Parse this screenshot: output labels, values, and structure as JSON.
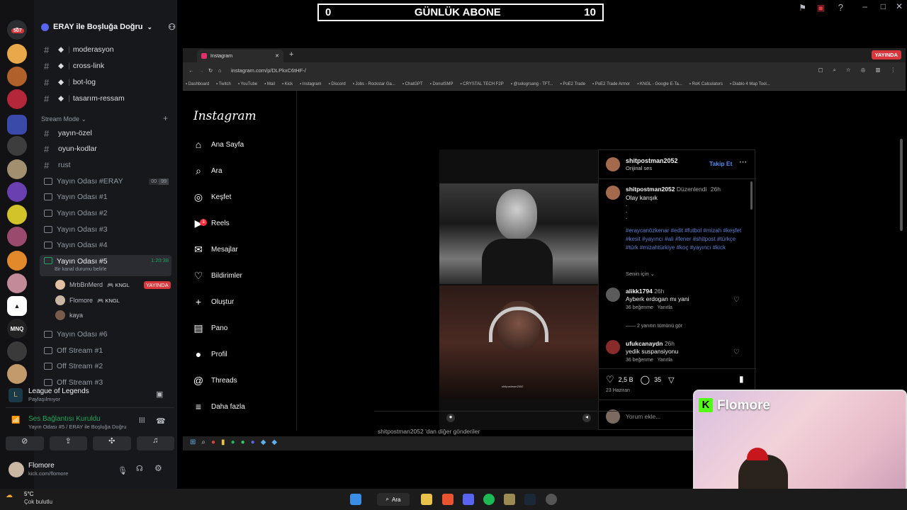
{
  "stream_overlay": {
    "left_count": "0",
    "title": "GÜNLÜK ABONE",
    "right_count": "10",
    "ghost_title": "ERAY ile Boşluğa Doğru"
  },
  "discord": {
    "badge_count": "507",
    "server_name": "ERAY ile Boşluğa Doğru",
    "text_channels": [
      "moderasyon",
      "cross-link",
      "bot-log",
      "tasarım-ressam"
    ],
    "category": "Stream Mode",
    "channels2": [
      "yayın-özel",
      "oyun-kodlar",
      "rust"
    ],
    "voice_channels_a": [
      "Yayın Odası #ERAY",
      "Yayın Odası #1",
      "Yayın Odası #2",
      "Yayın Odası #3",
      "Yayın Odası #4"
    ],
    "voice_counter": {
      "left": "00",
      "right": "99"
    },
    "active_voice": {
      "name": "Yayın Odası #5",
      "timer": "1:20:38",
      "status": "Bir kanal durumu belirle"
    },
    "voice_users": [
      {
        "name": "MrbBnMerd",
        "tag": "KNGL",
        "live": "YAYINDA"
      },
      {
        "name": "Flomore",
        "tag": "KNGL",
        "live": ""
      },
      {
        "name": "kaya",
        "tag": "",
        "live": ""
      }
    ],
    "voice_channels_b": [
      "Yayın Odası #6",
      "Off Stream #1",
      "Off Stream #2",
      "Off Stream #3"
    ],
    "activity": {
      "game": "League of Legends",
      "sub": "Paylaşılmıyor"
    },
    "connection": {
      "status": "Ses Bağlantısı Kuruldu",
      "detail": "Yayın Odası #5 / ERAY ile Boşluğa Doğru"
    },
    "user": {
      "name": "Flomore",
      "sub": "kick.com/flomore"
    }
  },
  "browser": {
    "tab_title": "Instagram",
    "url": "instagram.com/p/DLPkxC6tHF-/",
    "live_badge": "YAYINDA",
    "bookmarks": [
      "Dashboard",
      "Twitch",
      "YouTube",
      "Mail",
      "Kick",
      "Instagram",
      "Discord",
      "Jobs - Rockstar Ga...",
      "ChatGPT",
      "DonutSMP",
      "CRYSTAL TECH F2P",
      "@sologrsang - TFT...",
      "PoE2 Trade",
      "PoE2 Trade Armor",
      "KNGL - Google E-Ta...",
      "RoK Calculators",
      "Diablo 4 Map Tool..."
    ]
  },
  "instagram": {
    "logo": "Instagram",
    "nav": [
      "Ana Sayfa",
      "Ara",
      "Keşfet",
      "Reels",
      "Mesajlar",
      "Bildirimler",
      "Oluştur",
      "Pano",
      "Profil",
      "Threads",
      "Daha fazla"
    ],
    "messages_badge": "3",
    "post": {
      "author": "shitpostman2052",
      "audio": "Orijinal ses",
      "follow": "Takip Et",
      "edited": "Düzenlendi",
      "age": "26h",
      "caption": "Olay karışık",
      "dots": [
        ".",
        ".",
        "."
      ],
      "hashtags": "#eraycanözkenar #edit #futbol #mizah #keşfet #kesit #yayıncı #ali #fener #shitpost #türkçe #türk #mizahtürkiye #koç #yayıncı #kick",
      "for_you": "Senin için",
      "watermark": "shitpostman2052",
      "likes": "2,5 B",
      "comments_count": "35",
      "date": "23 Haziran",
      "add_comment": "Yorum ekle...",
      "more_from": "shitpostman2052 'dan diğer gönderiler"
    },
    "comments": [
      {
        "user": "alikk1794",
        "age": "26h",
        "text": "Ayberk erdogan mı yani",
        "likes": "36 beğenme",
        "reply": "Yanıtla",
        "view_replies": "2 yanıtın tümünü gör"
      },
      {
        "user": "ufukcanaydn",
        "age": "26h",
        "text": "yedik suspansiyonu",
        "likes": "36 beğenme",
        "reply": "Yanıtla"
      }
    ]
  },
  "webcam": {
    "name": "Flomore"
  },
  "taskbar": {
    "weather_temp": "5°C",
    "weather_desc": "Çok bulutlu",
    "search": "Ara"
  },
  "colors": {
    "discord_green": "#23a55a",
    "live_red": "#da373c",
    "kick_green": "#53fc18",
    "ig_blue": "#0095f6"
  }
}
